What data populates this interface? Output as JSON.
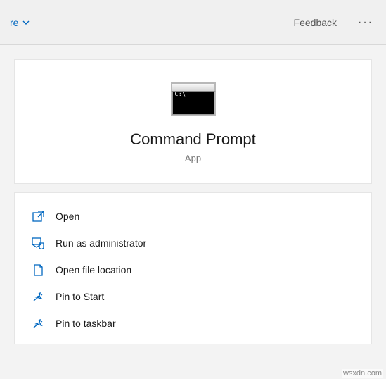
{
  "topbar": {
    "dropdown_fragment": "re",
    "feedback_label": "Feedback"
  },
  "header": {
    "title": "Command Prompt",
    "type": "App"
  },
  "actions": [
    {
      "icon": "open-icon",
      "label": "Open"
    },
    {
      "icon": "admin-icon",
      "label": "Run as administrator"
    },
    {
      "icon": "folder-icon",
      "label": "Open file location"
    },
    {
      "icon": "pin-start-icon",
      "label": "Pin to Start"
    },
    {
      "icon": "pin-taskbar-icon",
      "label": "Pin to taskbar"
    }
  ],
  "watermark": "wsxdn.com",
  "colors": {
    "accent": "#0067c0"
  }
}
